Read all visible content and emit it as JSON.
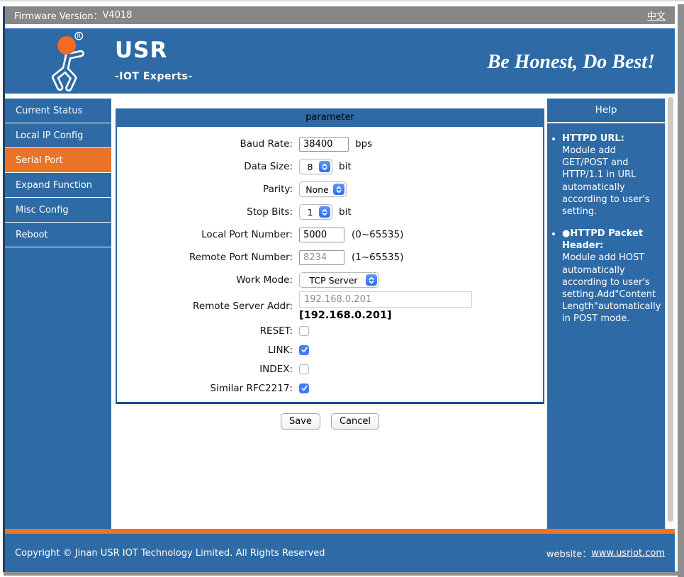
{
  "colors": {
    "brand_blue": "#2E6AA5",
    "accent_orange": "#E97326",
    "active_nav_orange": "#E97326",
    "select_blue": "#3E7FF8",
    "checkbox_blue": "#3E7FF8",
    "topbar_gray": "#878787",
    "form_border_blue": "#2A69A9",
    "logo_head_orange": "#F26C21"
  },
  "topbar": {
    "firmware_label": "Firmware Version：",
    "firmware_value": "V4018",
    "lang_link": "中文"
  },
  "header": {
    "brand": "USR",
    "brand_sub": "-IOT Experts-",
    "slogan": "Be Honest, Do Best!",
    "registered_mark": "R"
  },
  "sidebar": {
    "items": [
      {
        "label": "Current Status",
        "active": false
      },
      {
        "label": "Local IP Config",
        "active": false
      },
      {
        "label": "Serial Port",
        "active": true
      },
      {
        "label": "Expand Function",
        "active": false
      },
      {
        "label": "Misc Config",
        "active": false
      },
      {
        "label": "Reboot",
        "active": false
      }
    ]
  },
  "form": {
    "title": "parameter",
    "baud_rate": {
      "label": "Baud Rate:",
      "value": "38400",
      "suffix": "bps"
    },
    "data_size": {
      "label": "Data Size:",
      "value": "8",
      "suffix": "bit"
    },
    "parity": {
      "label": "Parity:",
      "value": "None"
    },
    "stop_bits": {
      "label": "Stop Bits:",
      "value": "1",
      "suffix": "bit"
    },
    "local_port": {
      "label": "Local Port Number:",
      "value": "5000",
      "hint": "(0~65535)"
    },
    "remote_port": {
      "label": "Remote Port Number:",
      "value": "8234",
      "hint": "(1~65535)"
    },
    "work_mode": {
      "label": "Work Mode:",
      "value": "TCP Server"
    },
    "remote_server": {
      "label": "Remote Server Addr:",
      "value": "192.168.0.201",
      "display": "[192.168.0.201]"
    },
    "reset": {
      "label": "RESET:",
      "checked": false
    },
    "link": {
      "label": "LINK:",
      "checked": true
    },
    "index": {
      "label": "INDEX:",
      "checked": false
    },
    "rfc2217": {
      "label": "Similar RFC2217:",
      "checked": true
    },
    "save_label": "Save",
    "cancel_label": "Cancel"
  },
  "help": {
    "title": "Help",
    "items": [
      {
        "heading": "HTTPD URL:",
        "body": "Module add GET/POST and HTTP/1.1 in URL automatically according to user's setting."
      },
      {
        "heading": "●HTTPD Packet Header:",
        "body": "Module add HOST automatically according to user's setting.Add\"Content Length\"automatically in POST mode."
      }
    ]
  },
  "footer": {
    "copyright": "Copyright © Jinan USR IOT Technology Limited. All Rights Reserved",
    "website_label": "website：",
    "website_link": "www.usriot.com"
  }
}
